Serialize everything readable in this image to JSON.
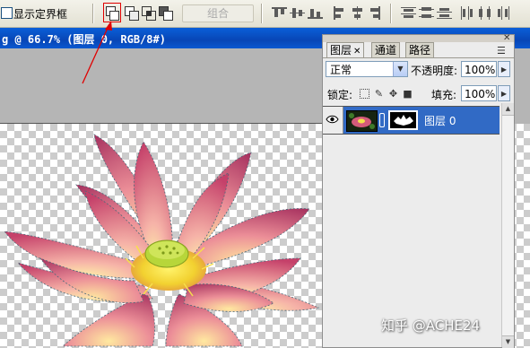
{
  "options_bar": {
    "show_bounding_box_label": "显示定界框",
    "show_bounding_box_checked": false,
    "shape_mode_buttons": [
      "add-to-shape-area",
      "subtract-from-shape-area",
      "intersect-shape-areas",
      "exclude-overlapping-shape-areas"
    ],
    "highlighted_button": "add-to-shape-area",
    "combine_label": "组合",
    "combine_enabled": false,
    "align_buttons": [
      "align-top-edges",
      "align-vertical-centers",
      "align-bottom-edges",
      "align-left-edges",
      "align-horizontal-centers",
      "align-right-edges"
    ],
    "distribute_buttons": [
      "distribute-top-edges",
      "distribute-vertical-centers",
      "distribute-bottom-edges",
      "distribute-left-edges",
      "distribute-horizontal-centers",
      "distribute-right-edges"
    ]
  },
  "document": {
    "title_fragment": "g @ 66.7% (图层 0, RGB/8#)"
  },
  "annotation": {
    "type": "red-arrow-and-box",
    "color": "#e00000",
    "points_to": "add-to-shape-area"
  },
  "layers_panel": {
    "tabs": [
      {
        "label": "图层",
        "active": true,
        "closable": true
      },
      {
        "label": "通道",
        "active": false
      },
      {
        "label": "路径",
        "active": false
      }
    ],
    "blend_mode": "正常",
    "opacity_label": "不透明度:",
    "opacity_value": "100%",
    "lock_label": "锁定:",
    "lock_icons": [
      "lock-transparent-pixels",
      "lock-image-pixels",
      "lock-position",
      "lock-all"
    ],
    "fill_label": "填充:",
    "fill_value": "100%",
    "layers": [
      {
        "name": "图层 0",
        "visible": true,
        "selected": true,
        "has_mask": true
      }
    ]
  },
  "watermark": "知乎 @ACHE24",
  "colors": {
    "title_bar": "#0846b6",
    "selected_layer": "#316ac5",
    "annotation_red": "#e00000"
  }
}
